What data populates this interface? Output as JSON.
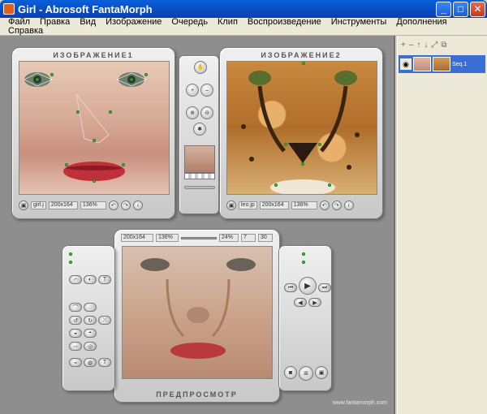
{
  "window": {
    "title": "Girl - Abrosoft FantaMorph",
    "min": "_",
    "max": "□",
    "close": "✕"
  },
  "menu": [
    "Файл",
    "Правка",
    "Вид",
    "Изображение",
    "Очередь",
    "Клип",
    "Воспроизведение",
    "Инструменты",
    "Дополнения",
    "Справка"
  ],
  "image1": {
    "title": "ИЗОБРАЖЕНИЕ1",
    "filename": "girl.j",
    "size": "200x164",
    "zoom": "136%"
  },
  "image2": {
    "title": "ИЗОБРАЖЕНИЕ2",
    "filename": "leo.jp",
    "size": "200x164",
    "zoom": "136%"
  },
  "preview": {
    "title": "ПРЕДПРОСМОТР",
    "size": "200x164",
    "zoom": "136%",
    "percent": "24%",
    "frame": "7",
    "total": "30"
  },
  "layer": {
    "label": "Seq.1"
  },
  "watermark": "www.fantamorph.com",
  "side_toolbar": [
    "+",
    "–",
    "↑",
    "↓",
    "⤢",
    "⧉"
  ],
  "colors": {
    "titlebar": "#0a4fd0",
    "workspace": "#8e8e8e",
    "selection": "#3a6ed5",
    "point": "#3bd13b"
  }
}
